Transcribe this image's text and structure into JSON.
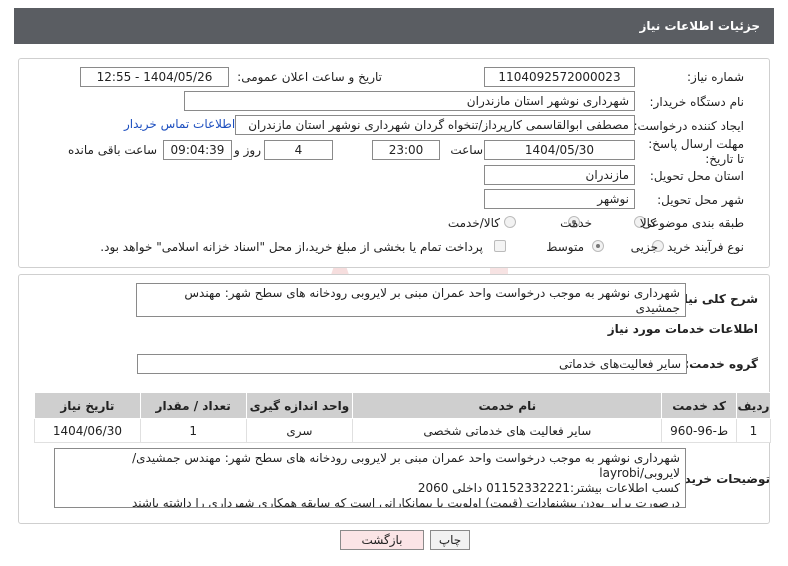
{
  "header": {
    "title": "جزئیات اطلاعات نیاز"
  },
  "form": {
    "need_number": {
      "label": "شماره نیاز:",
      "value": "1104092572000023"
    },
    "announce_datetime": {
      "label": "تاریخ و ساعت اعلان عمومی:",
      "value": "1404/05/26 - 12:55"
    },
    "buyer_org": {
      "label": "نام دستگاه خریدار:",
      "value": "شهرداری نوشهر استان مازندران"
    },
    "requester": {
      "label": "ایجاد کننده درخواست:",
      "value": "مصطفی  ابوالقاسمی کارپرداز/تنخواه گردان شهرداری نوشهر استان مازندران",
      "contact_link": "اطلاعات تماس خریدار"
    },
    "deadline": {
      "label": "مهلت ارسال پاسخ: تا تاریخ:",
      "date": "1404/05/30",
      "time_label": "ساعت",
      "time": "23:00",
      "days": "4",
      "days_label": "روز و",
      "remaining": "09:04:39",
      "remaining_label": "ساعت باقی مانده"
    },
    "delivery_province": {
      "label": "استان محل تحویل:",
      "value": "مازندران"
    },
    "delivery_city": {
      "label": "شهر محل تحویل:",
      "value": "نوشهر"
    },
    "category": {
      "label": "طبقه بندی موضوعی:",
      "options": [
        "کالا",
        "خدمت",
        "کالا/خدمت"
      ],
      "selected": "خدمت"
    },
    "process_type": {
      "label": "نوع فرآیند خرید :",
      "options": [
        "جزیی",
        "متوسط"
      ],
      "selected": "متوسط",
      "payment_note": "پرداخت تمام یا بخشی از مبلغ خرید،از محل \"اسناد خزانه اسلامی\" خواهد بود."
    }
  },
  "summary": {
    "label": "شرح کلی نیاز:",
    "value": "شهرداری نوشهر به موجب درخواست واحد عمران مبنی بر لایروبی رودخانه های سطح شهر: مهندس جمشیدی"
  },
  "services": {
    "section_title": "اطلاعات خدمات مورد نیاز",
    "group_label": "گروه خدمت:",
    "group_value": "سایر فعالیت‌های خدماتی",
    "table": {
      "headers": [
        "ردیف",
        "کد خدمت",
        "نام خدمت",
        "واحد اندازه گیری",
        "تعداد / مقدار",
        "تاریخ نیاز"
      ],
      "rows": [
        [
          "1",
          "ط-96-960",
          "سایر فعالیت های خدماتی شخصی",
          "سری",
          "1",
          "1404/06/30"
        ]
      ]
    }
  },
  "buyer_notes": {
    "label": "توضیحات خریدار:",
    "lines": [
      "شهرداری نوشهر به موجب درخواست واحد عمران مبنی بر لایروبی رودخانه های سطح شهر: مهندس جمشیدی/",
      "لایروبی/layrobi",
      "کسب اطلاعات بیشتر:01152332221 داخلی 2060",
      "درصورت برابر بودن پیشنهادات (قیمت) اولویت با پیمانکارانی است که سابقه همکاری شهرداری را داشته باشند"
    ]
  },
  "actions": {
    "print": "چاپ",
    "back": "بازگشت"
  },
  "colors": {
    "header_bg": "#5a5d62",
    "table_header_bg": "#cfcfcf",
    "link": "#1d4fbf",
    "back_button_bg": "#fbe4e6",
    "watermark": "#e9a5a5"
  }
}
